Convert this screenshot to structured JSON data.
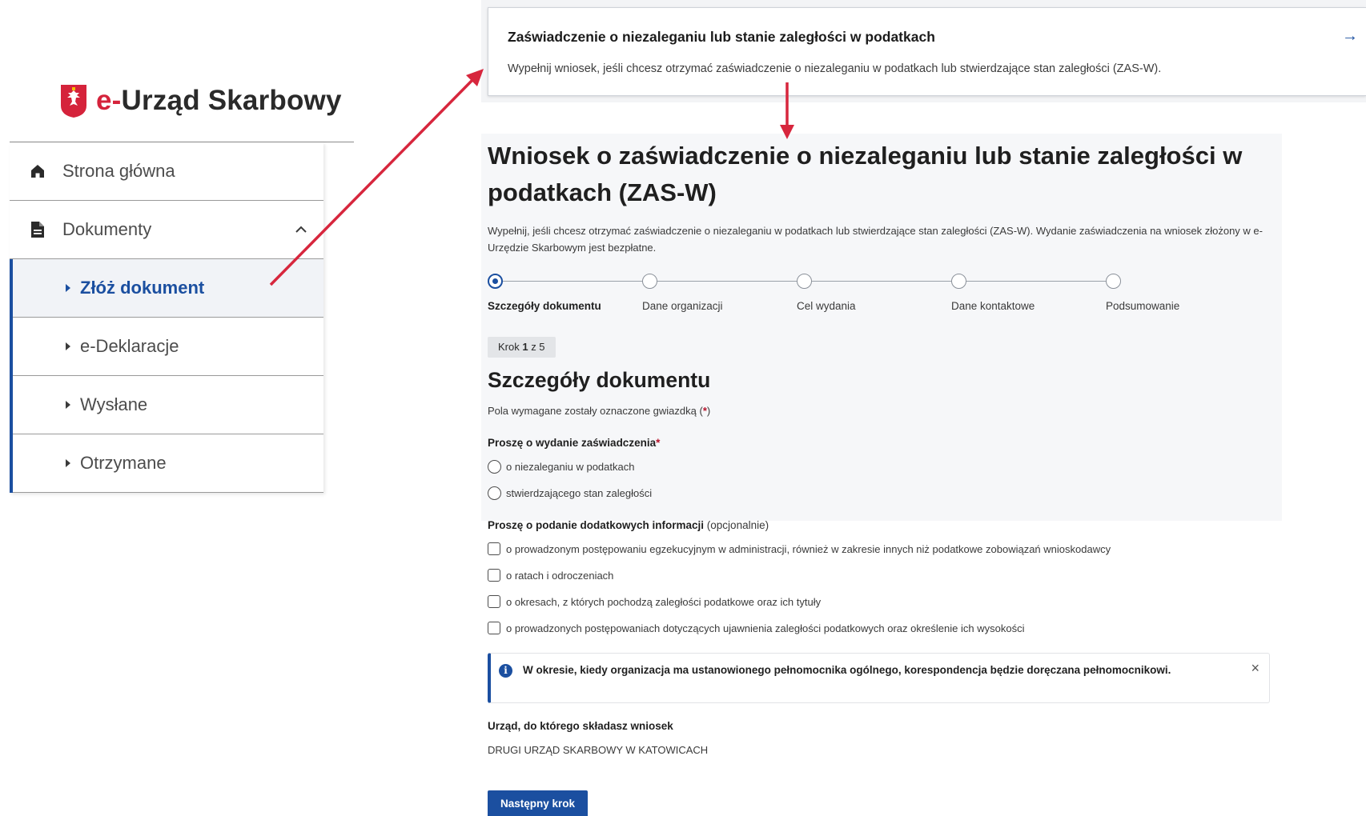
{
  "brand": {
    "prefix": "e-",
    "name": "Urząd Skarbowy"
  },
  "sidebar": {
    "items": [
      {
        "label": "Strona główna",
        "icon": "home-icon"
      },
      {
        "label": "Dokumenty",
        "icon": "document-icon",
        "expanded": true
      }
    ],
    "subitems": [
      {
        "label": "Złóż dokument",
        "active": true
      },
      {
        "label": "e-Deklaracje"
      },
      {
        "label": "Wysłane"
      },
      {
        "label": "Otrzymane"
      }
    ]
  },
  "card": {
    "title": "Zaświadczenie o niezaleganiu lub stanie zaległości w podatkach",
    "description": "Wypełnij wniosek, jeśli chcesz otrzymać zaświadczenie o niezaleganiu w podatkach lub stwierdzające stan zaległości (ZAS-W).",
    "arrow": "→"
  },
  "form": {
    "title": "Wniosek o zaświadczenie o niezaleganiu lub stanie zaległości w podatkach (ZAS-W)",
    "lead": "Wypełnij, jeśli chcesz otrzymać zaświadczenie o niezaleganiu w podatkach lub stwierdzające stan zaległości (ZAS-W). Wydanie zaświadczenia na wniosek złożony w e-Urzędzie Skarbowym jest bezpłatne.",
    "steps": [
      {
        "label": "Szczegóły dokumentu",
        "current": true
      },
      {
        "label": "Dane organizacji"
      },
      {
        "label": "Cel wydania"
      },
      {
        "label": "Dane kontaktowe"
      },
      {
        "label": "Podsumowanie"
      }
    ],
    "badge": {
      "prefix": "Krok ",
      "current": "1",
      "suffix": " z 5"
    },
    "section_title": "Szczegóły dokumentu",
    "required_note": {
      "text": "Pola wymagane zostały oznaczone gwiazdką (",
      "star": "*",
      "close": ")"
    },
    "certificate_question": {
      "label": "Proszę o wydanie zaświadczenia",
      "star": "*"
    },
    "certificate_options": [
      "o niezaleganiu w podatkach",
      "stwierdzającego stan zaległości"
    ],
    "additional_question": {
      "label": "Proszę o podanie dodatkowych informacji",
      "optional": " (opcjonalnie)"
    },
    "additional_options": [
      "o prowadzonym postępowaniu egzekucyjnym w administracji, również w zakresie innych niż podatkowe zobowiązań wnioskodawcy",
      "o ratach i odroczeniach",
      "o okresach, z których pochodzą zaległości podatkowe oraz ich tytuły",
      "o prowadzonych postępowaniach dotyczących ujawnienia zaległości podatkowych oraz określenie ich wysokości"
    ],
    "alert": {
      "icon": "i",
      "text": "W okresie, kiedy organizacja ma ustanowionego pełnomocnika ogólnego, korespondencja będzie doręczana pełnomocnikowi.",
      "close": "×"
    },
    "office_label": "Urząd, do którego składasz wniosek",
    "office_value": "DRUGI URZĄD SKARBOWY W KATOWICACH",
    "next_button": "Następny krok"
  },
  "colors": {
    "accent": "#1b4fa0",
    "brand_red": "#d5233b",
    "annotation_red": "#d7263d"
  }
}
